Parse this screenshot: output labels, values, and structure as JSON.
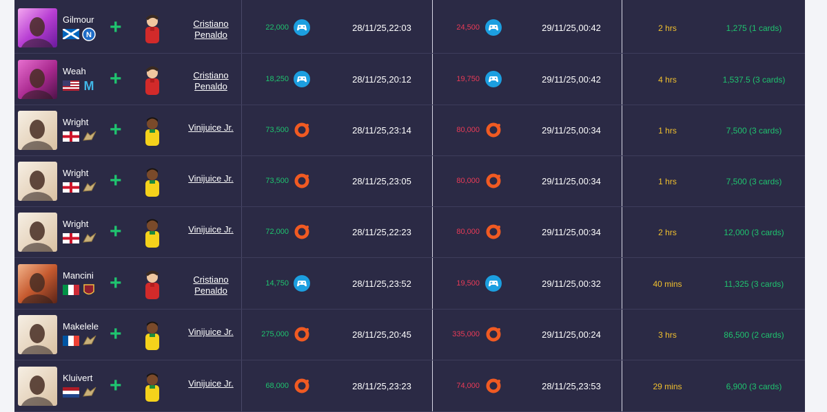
{
  "rows": [
    {
      "player": "Gilmour",
      "card": "purple",
      "flags": [
        "scotland",
        "napoli"
      ],
      "target": "Cristiano\nPenaldo",
      "target_line1": "Cristiano",
      "target_line2": "Penaldo",
      "avatar": "ronaldo",
      "buy": "22,000",
      "buy_platform": "playstation",
      "buy_date": "28/11/25,22:03",
      "sell": "24,500",
      "sell_platform": "playstation",
      "sell_date": "29/11/25,00:42",
      "duration": "2 hrs",
      "profit": "1,275 (1 cards)"
    },
    {
      "player": "Weah",
      "card": "magenta",
      "flags": [
        "usa",
        "marseille"
      ],
      "target_line1": "Cristiano",
      "target_line2": "Penaldo",
      "avatar": "ronaldo",
      "buy": "18,250",
      "buy_platform": "playstation",
      "buy_date": "28/11/25,20:12",
      "sell": "19,750",
      "sell_platform": "playstation",
      "sell_date": "29/11/25,00:42",
      "duration": "4 hrs",
      "profit": "1,537.5 (3 cards)"
    },
    {
      "player": "Wright",
      "card": "gold",
      "flags": [
        "england",
        "icon"
      ],
      "target_line1": "Vinijuice Jr.",
      "target_line2": "",
      "avatar": "vinicius",
      "buy": "73,500",
      "buy_platform": "origin",
      "buy_date": "28/11/25,23:14",
      "sell": "80,000",
      "sell_platform": "origin",
      "sell_date": "29/11/25,00:34",
      "duration": "1 hrs",
      "profit": "7,500 (3 cards)"
    },
    {
      "player": "Wright",
      "card": "gold",
      "flags": [
        "england",
        "icon"
      ],
      "target_line1": "Vinijuice Jr.",
      "target_line2": "",
      "avatar": "vinicius",
      "buy": "73,500",
      "buy_platform": "origin",
      "buy_date": "28/11/25,23:05",
      "sell": "80,000",
      "sell_platform": "origin",
      "sell_date": "29/11/25,00:34",
      "duration": "1 hrs",
      "profit": "7,500 (3 cards)"
    },
    {
      "player": "Wright",
      "card": "gold",
      "flags": [
        "england",
        "icon"
      ],
      "target_line1": "Vinijuice Jr.",
      "target_line2": "",
      "avatar": "vinicius",
      "buy": "72,000",
      "buy_platform": "origin",
      "buy_date": "28/11/25,22:23",
      "sell": "80,000",
      "sell_platform": "origin",
      "sell_date": "29/11/25,00:34",
      "duration": "2 hrs",
      "profit": "12,000 (3 cards)"
    },
    {
      "player": "Mancini",
      "card": "orange",
      "flags": [
        "italy",
        "roma"
      ],
      "target_line1": "Cristiano",
      "target_line2": "Penaldo",
      "avatar": "ronaldo",
      "buy": "14,750",
      "buy_platform": "playstation",
      "buy_date": "28/11/25,23:52",
      "sell": "19,500",
      "sell_platform": "playstation",
      "sell_date": "29/11/25,00:32",
      "duration": "40 mins",
      "profit": "11,325 (3 cards)"
    },
    {
      "player": "Makelele",
      "card": "gold",
      "flags": [
        "france",
        "icon"
      ],
      "target_line1": "Vinijuice Jr.",
      "target_line2": "",
      "avatar": "vinicius",
      "buy": "275,000",
      "buy_platform": "origin",
      "buy_date": "28/11/25,20:45",
      "sell": "335,000",
      "sell_platform": "origin",
      "sell_date": "29/11/25,00:24",
      "duration": "3 hrs",
      "profit": "86,500 (2 cards)"
    },
    {
      "player": "Kluivert",
      "card": "gold",
      "flags": [
        "netherlands",
        "icon"
      ],
      "target_line1": "Vinijuice Jr.",
      "target_line2": "",
      "avatar": "vinicius",
      "buy": "68,000",
      "buy_platform": "origin",
      "buy_date": "28/11/25,23:23",
      "sell": "74,000",
      "sell_platform": "origin",
      "sell_date": "28/11/25,23:53",
      "duration": "29 mins",
      "profit": "6,900 (3 cards)"
    }
  ],
  "colors": {
    "bg": "#2b2a45",
    "profit": "#1fc46f",
    "loss": "#ea3b57",
    "duration": "#f2c12e",
    "playstation": "#1c9fe0",
    "origin": "#f05a22"
  }
}
